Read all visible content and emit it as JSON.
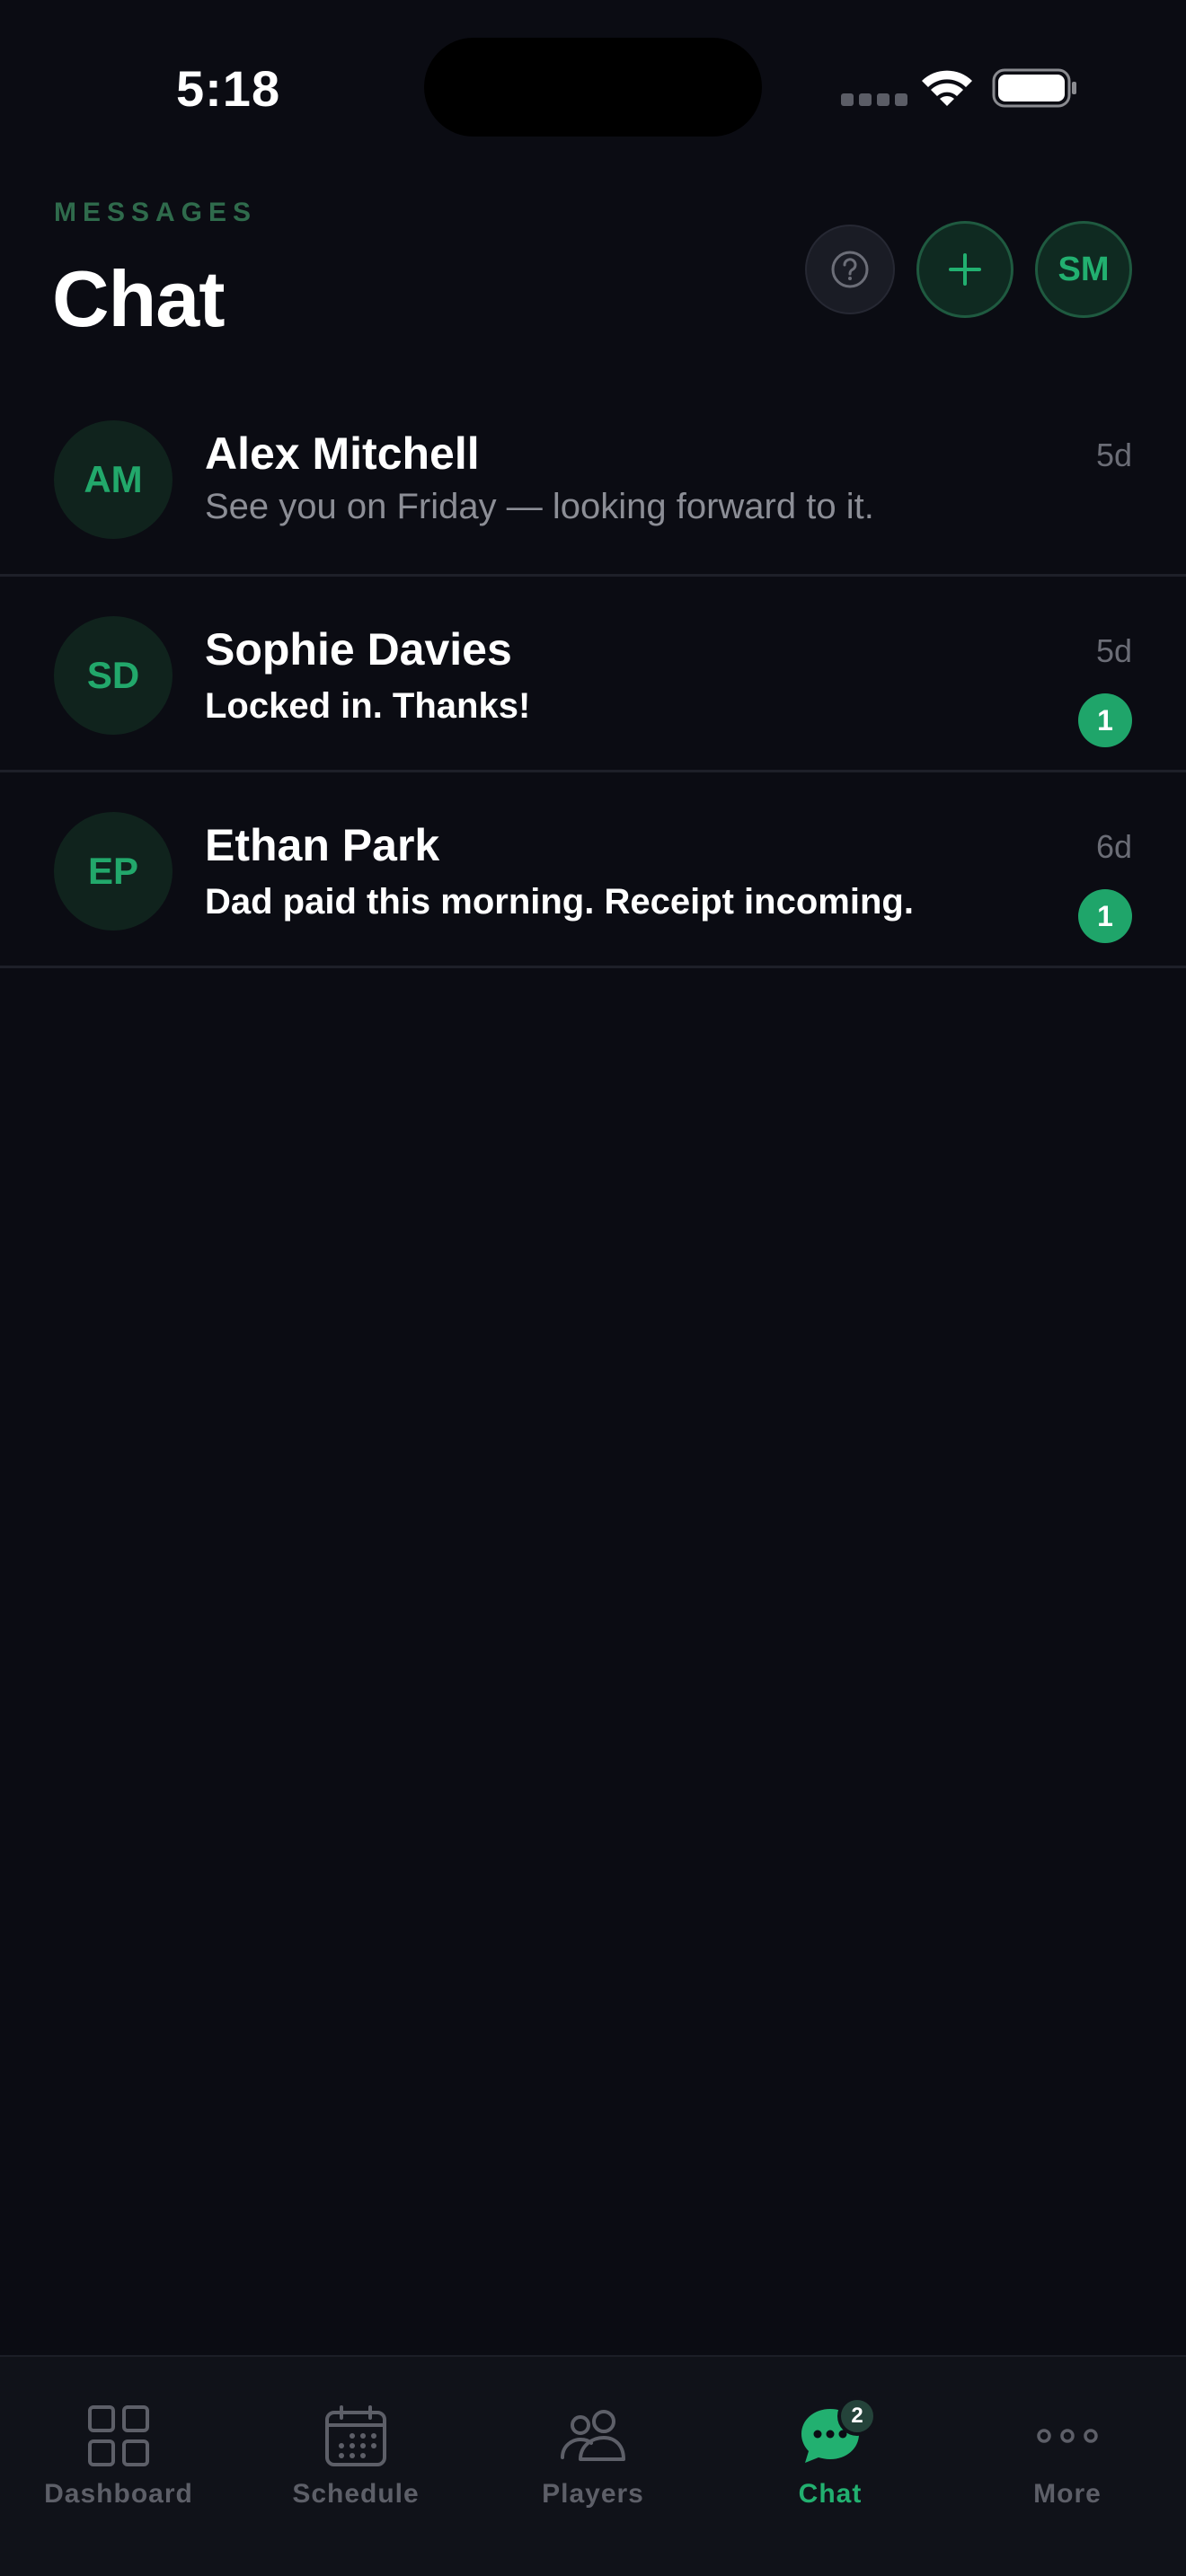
{
  "status_bar": {
    "time": "5:18",
    "wifi_icon": "wifi-icon",
    "battery_icon": "battery-icon"
  },
  "header": {
    "eyebrow": "MESSAGES",
    "title": "Chat",
    "help_icon": "question-circle-icon",
    "add_icon": "plus-icon",
    "profile_initials": "SM"
  },
  "chats": [
    {
      "initials": "AM",
      "name": "Alex Mitchell",
      "preview": "See you on Friday — looking forward to it.",
      "time": "5d",
      "unread": ""
    },
    {
      "initials": "SD",
      "name": "Sophie Davies",
      "preview": "Locked in. Thanks!",
      "time": "5d",
      "unread": "1"
    },
    {
      "initials": "EP",
      "name": "Ethan Park",
      "preview": "Dad paid this morning. Receipt incoming.",
      "time": "6d",
      "unread": "1"
    }
  ],
  "tabs": [
    {
      "label": "Dashboard",
      "icon": "grid-icon"
    },
    {
      "label": "Schedule",
      "icon": "calendar-icon"
    },
    {
      "label": "Players",
      "icon": "people-icon"
    },
    {
      "label": "Chat",
      "icon": "chat-bubble-icon",
      "badge": "2",
      "active": true
    },
    {
      "label": "More",
      "icon": "more-dots-icon"
    }
  ],
  "colors": {
    "accent": "#22b070",
    "background": "#0b0c13",
    "avatar_bg": "#10231d"
  }
}
